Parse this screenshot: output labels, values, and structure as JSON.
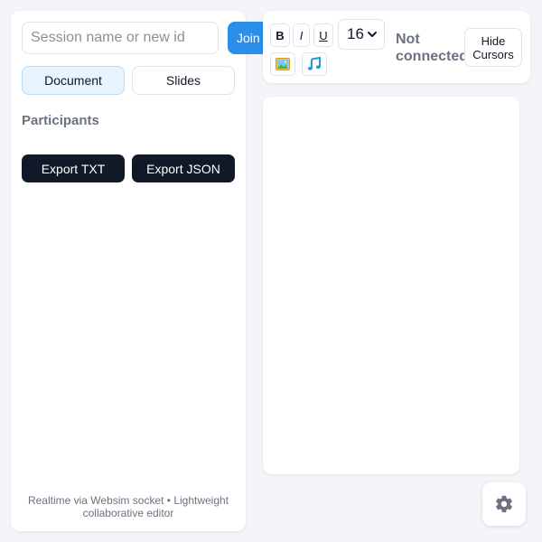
{
  "session": {
    "placeholder": "Session name or new id",
    "join_label": "Join"
  },
  "modes": [
    {
      "label": "Document",
      "active": true
    },
    {
      "label": "Slides",
      "active": false
    }
  ],
  "participants": {
    "title": "Participants"
  },
  "export": {
    "txt_label": "Export TXT",
    "json_label": "Export JSON"
  },
  "footer": {
    "text": "Realtime via Websim socket • Lightweight collaborative editor"
  },
  "toolbar": {
    "bold_label": "B",
    "italic_label": "I",
    "underline_label": "U",
    "font_size": "16",
    "image_icon": "image-icon",
    "audio_icon": "music-note-icon",
    "status": "Not connected",
    "cursors_label": "Hide Cursors"
  },
  "settings": {
    "icon": "gear-icon"
  },
  "colors": {
    "accent": "#2b8fe9",
    "dark_button": "#111827",
    "active_mode_bg": "#e7f3fd",
    "background": "#f3f5f9"
  }
}
